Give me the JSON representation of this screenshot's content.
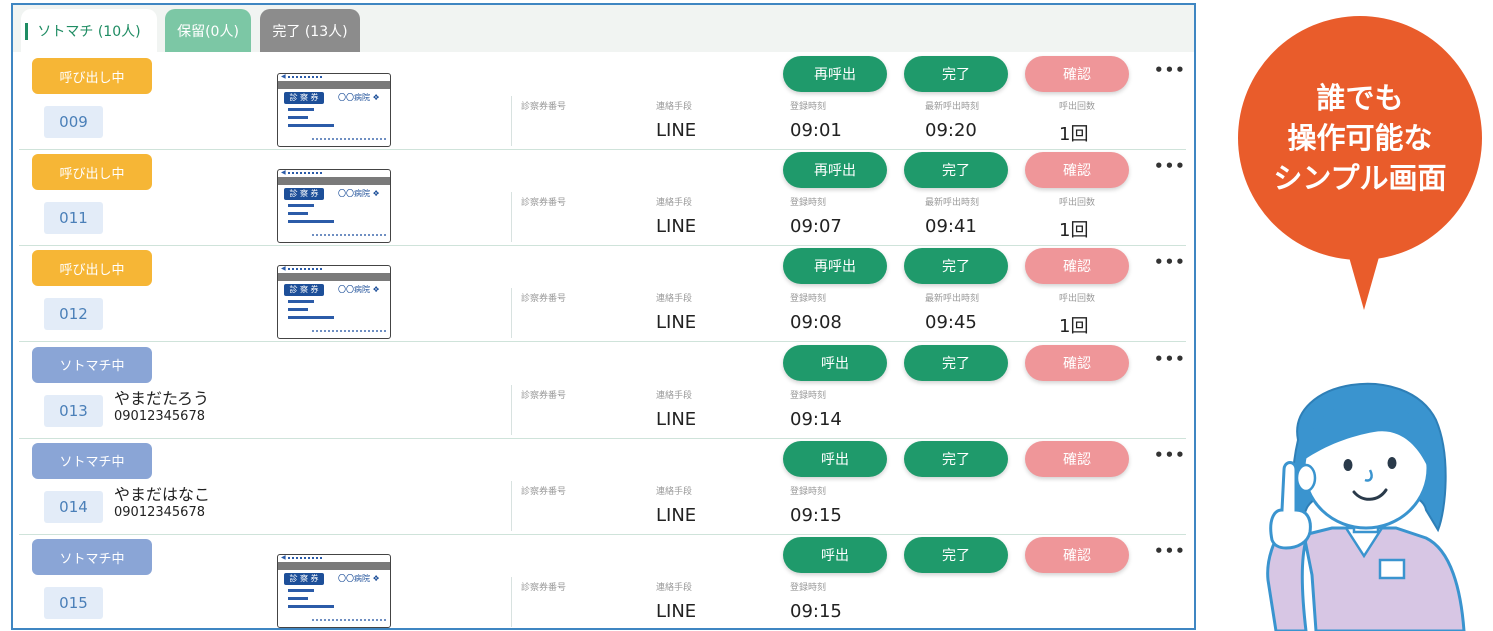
{
  "tabs": [
    {
      "label": "ソトマチ (10人)"
    },
    {
      "label": "保留(0人)"
    },
    {
      "label": "完了 (13人)"
    }
  ],
  "field_labels": {
    "card_number": "診察券番号",
    "contact": "連絡手段",
    "registered_at": "登録時刻",
    "last_called_at": "最新呼出時刻",
    "call_count": "呼出回数"
  },
  "buttons": {
    "recall": "再呼出",
    "call": "呼出",
    "complete": "完了",
    "confirm": "確認",
    "more": "•••"
  },
  "card_image": {
    "label": "診 察 券",
    "hospital": "〇〇病院 ❖"
  },
  "rows": [
    {
      "status": "呼び出し中",
      "status_type": "calling",
      "number": "009",
      "name": "",
      "phone": "",
      "has_card": true,
      "contact": "LINE",
      "registered": "09:01",
      "last_called": "09:20",
      "count": "1回"
    },
    {
      "status": "呼び出し中",
      "status_type": "calling",
      "number": "011",
      "name": "",
      "phone": "",
      "has_card": true,
      "contact": "LINE",
      "registered": "09:07",
      "last_called": "09:41",
      "count": "1回"
    },
    {
      "status": "呼び出し中",
      "status_type": "calling",
      "number": "012",
      "name": "",
      "phone": "",
      "has_card": true,
      "contact": "LINE",
      "registered": "09:08",
      "last_called": "09:45",
      "count": "1回"
    },
    {
      "status": "ソトマチ中",
      "status_type": "waiting",
      "number": "013",
      "name": "やまだたろう",
      "phone": "09012345678",
      "has_card": false,
      "contact": "LINE",
      "registered": "09:14",
      "last_called": "",
      "count": ""
    },
    {
      "status": "ソトマチ中",
      "status_type": "waiting",
      "number": "014",
      "name": "やまだはなこ",
      "phone": "09012345678",
      "has_card": false,
      "contact": "LINE",
      "registered": "09:15",
      "last_called": "",
      "count": ""
    },
    {
      "status": "ソトマチ中",
      "status_type": "waiting",
      "number": "015",
      "name": "",
      "phone": "",
      "has_card": true,
      "contact": "LINE",
      "registered": "09:15",
      "last_called": "",
      "count": ""
    }
  ],
  "colors": {
    "calling": "#f6b636",
    "waiting": "#8aa5d6",
    "green_button": "#1f9a6b",
    "confirm_button": "#ef9699",
    "bubble": "#e95c2b",
    "panel_border": "#3f86c2"
  },
  "promo": {
    "lines": [
      "誰でも",
      "操作可能な",
      "シンプル画面"
    ],
    "illustration": "nurse-pointing-icon"
  }
}
